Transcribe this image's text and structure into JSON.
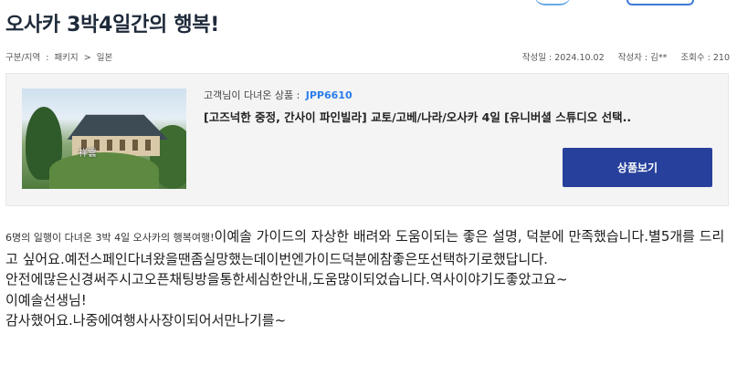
{
  "page": {
    "title": "오사카 3박4일간의 행복!"
  },
  "breadcrumb": {
    "label": "구분/지역",
    "separator": ":",
    "items": [
      "패키지",
      "일본"
    ],
    "arrow": ">"
  },
  "meta": {
    "date": "작성일 : 2024.10.02",
    "author": "작성자 : 김**",
    "views": "조회수 : 210"
  },
  "product": {
    "label": "고객님이 다녀온 상품 :",
    "code": "JPP6610",
    "title": "[고즈넉한 중정, 간사이 파인빌라] 교토/고베/나라/오사카 4일 [유니버셜 스튜디오 선택..",
    "button_label": "상품보기",
    "image_caption": "祥雲"
  },
  "review": {
    "lead": "6명의 일행이 다녀온 3박 4일 오사카의 행복여행!",
    "line1": "이예솔 가이드의 자상한 배려와 도움이되는 좋은 설명, 덕분에 만족했습니다.별5개를 드리고 싶어요.예전스페인다녀왔을땐좀실망했는데이번엔가이드덕분에참좋은또선택하기로했답니다.",
    "line2": "안전에많은신경써주시고오픈채팅방을통한세심한안내,도움많이되었습니다.역사이야기도좋았고요~",
    "line3": "이예솔선생님!",
    "line4": "감사했어요.나중에여행사사장이되어서만나기를~"
  },
  "colors": {
    "accent": "#26409b",
    "code": "#2b7de9"
  }
}
